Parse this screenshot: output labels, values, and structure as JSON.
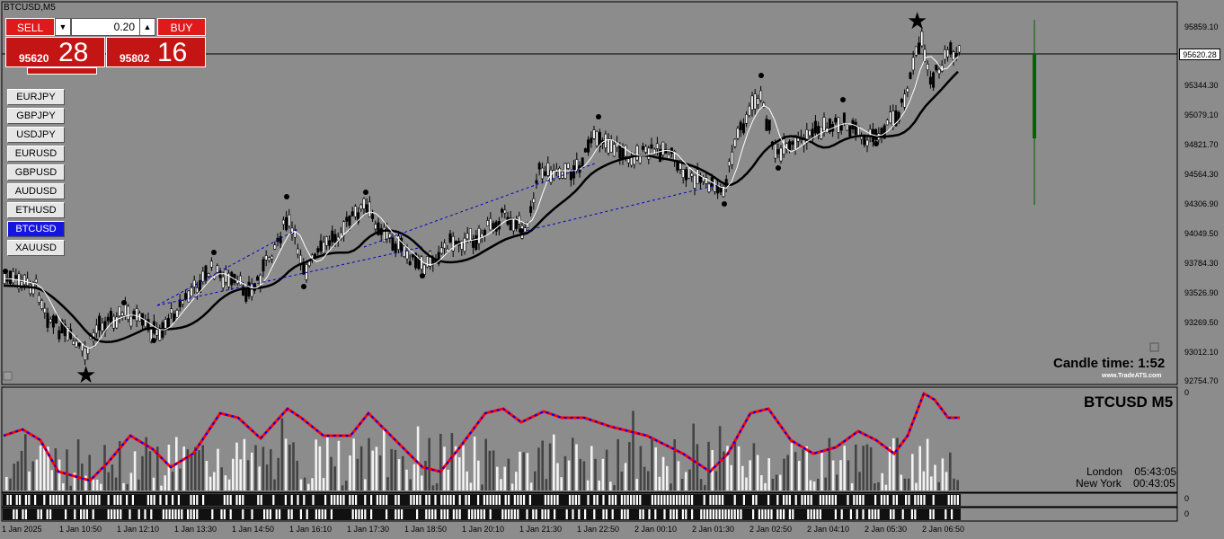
{
  "window": {
    "title": "BTCUSD,M5"
  },
  "trade_panel": {
    "sell_label": "SELL",
    "buy_label": "BUY",
    "lot_value": "0.20",
    "sell_price_prefix": "95620",
    "sell_price_big": "28",
    "buy_price_prefix": "95802",
    "buy_price_big": "16"
  },
  "symbols": [
    "EURJPY",
    "GBPJPY",
    "USDJPY",
    "EURUSD",
    "GBPUSD",
    "AUDUSD",
    "ETHUSD",
    "BTCUSD",
    "XAUUSD"
  ],
  "active_symbol": "BTCUSD",
  "price_axis": [
    "95859.10",
    "95620.28",
    "95344.30",
    "95079.10",
    "94821.70",
    "94564.30",
    "94306.90",
    "94049.50",
    "93784.30",
    "93526.90",
    "93269.50",
    "93012.10",
    "92754.70"
  ],
  "current_price_tag": "95620.28",
  "time_axis": [
    "1 Jan 2025",
    "1 Jan 10:50",
    "1 Jan 12:10",
    "1 Jan 13:30",
    "1 Jan 14:50",
    "1 Jan 16:10",
    "1 Jan 17:30",
    "1 Jan 18:50",
    "1 Jan 20:10",
    "1 Jan 21:30",
    "1 Jan 22:50",
    "2 Jan 00:10",
    "2 Jan 01:30",
    "2 Jan 02:50",
    "2 Jan 04:10",
    "2 Jan 05:30",
    "2 Jan 06:50"
  ],
  "candle_time": {
    "label": "Candle time:",
    "value": "1:52"
  },
  "watermark": "www.TradeATS.com",
  "indicator": {
    "title": "BTCUSD  M5",
    "axis_top": "0",
    "axis_mid": "0",
    "axis_bottom": "0"
  },
  "clocks": [
    {
      "city": "London",
      "time": "05:43:05"
    },
    {
      "city": "New York",
      "time": "00:43:05"
    }
  ],
  "colors": {
    "background": "#8c8c8c",
    "sell": "#e01a1a",
    "buy": "#e01a1a",
    "active_symbol": "#1515e0",
    "line_red": "#ff0000",
    "line_blue": "#0000ff"
  }
}
